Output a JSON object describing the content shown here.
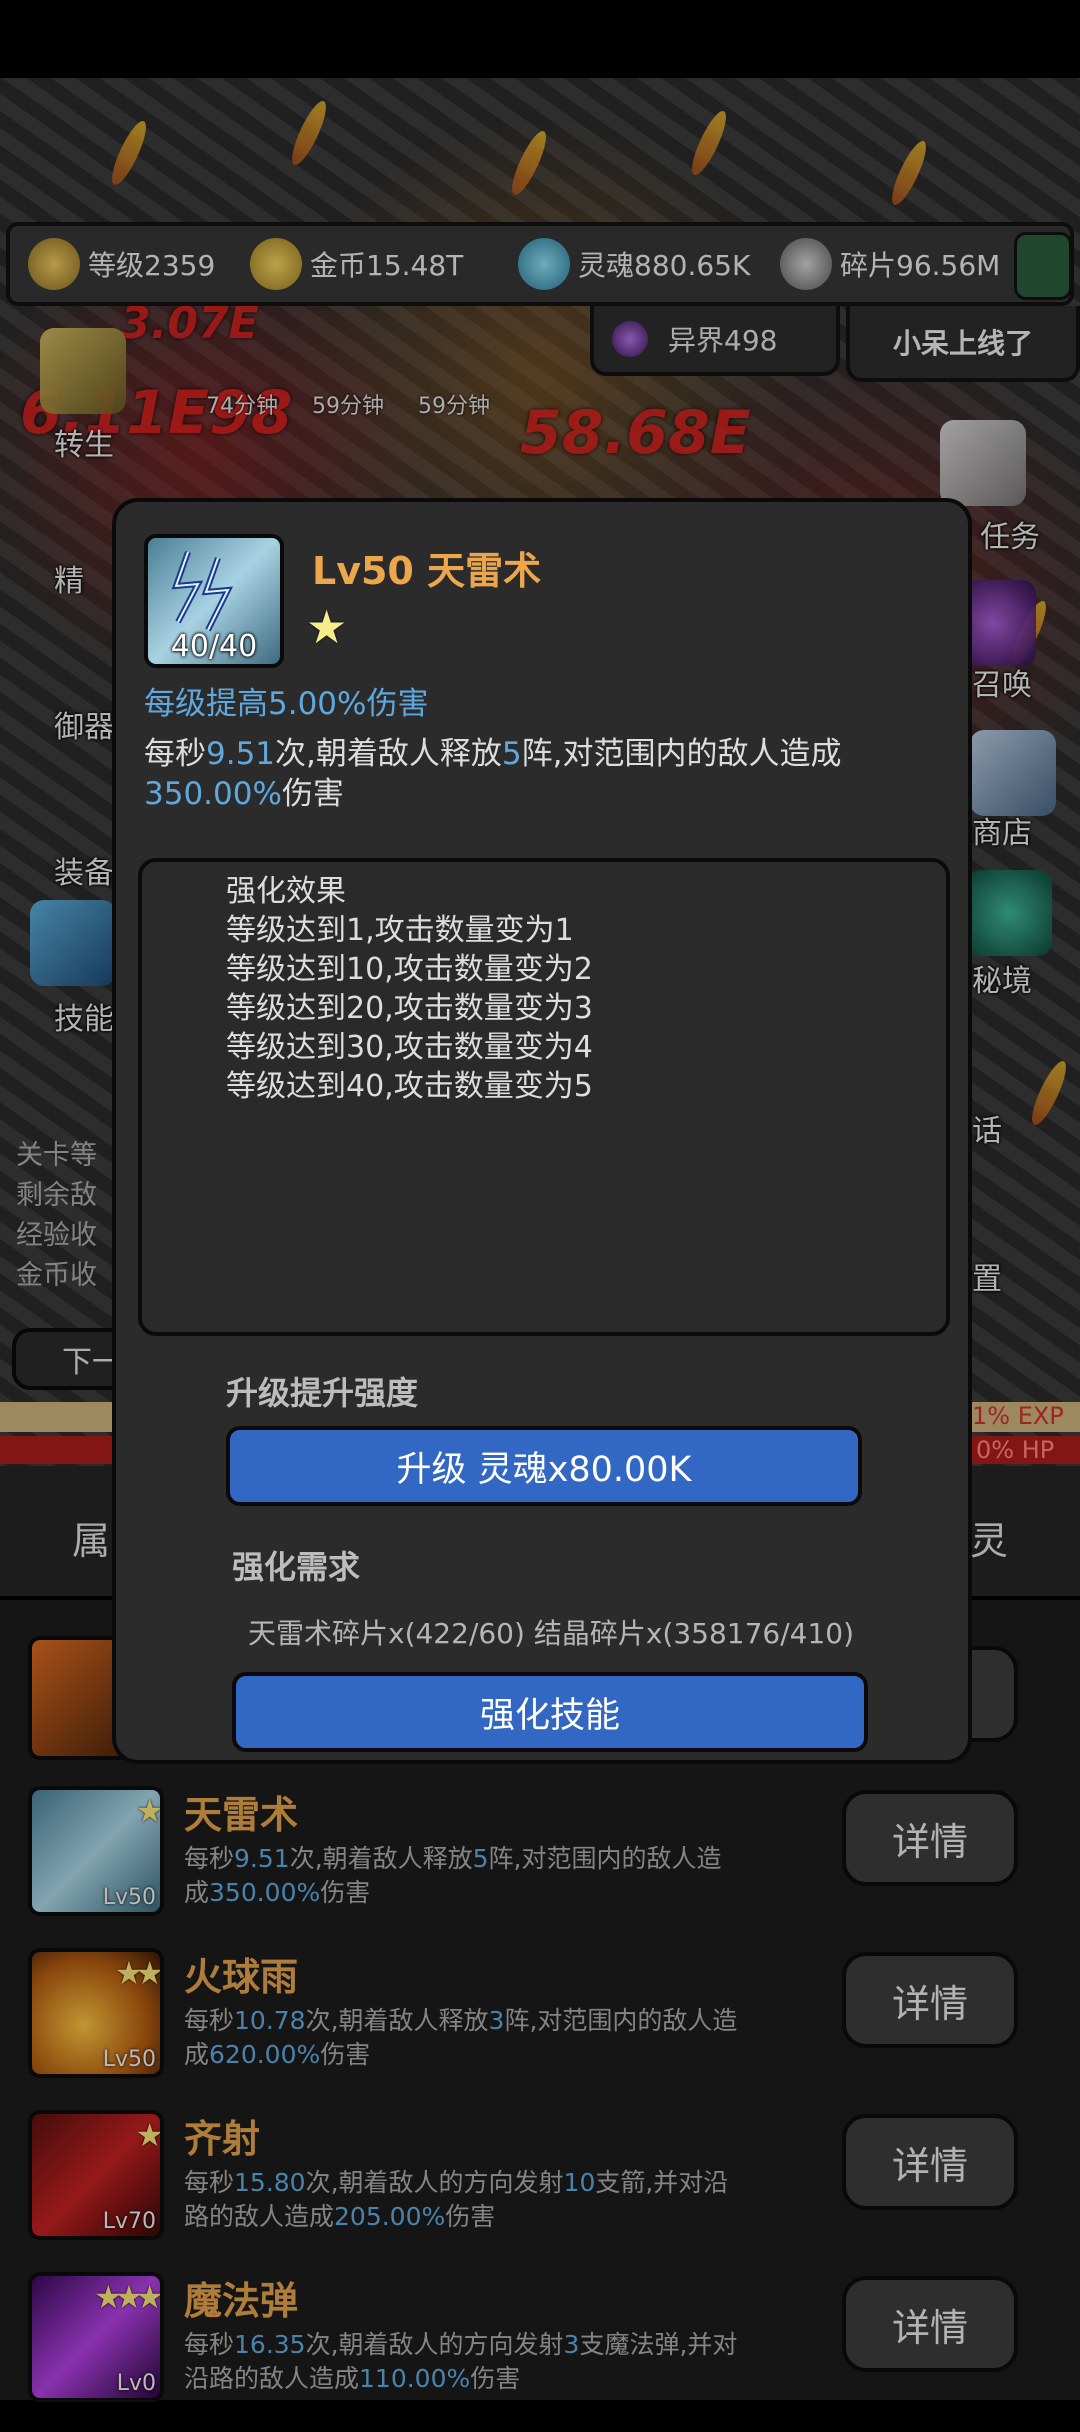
{
  "resources": {
    "level": "等级2359",
    "gold": "金币15.48T",
    "soul": "灵魂880.65K",
    "fragments": "碎片96.56M",
    "realm": "异界498",
    "online": "小呆上线了"
  },
  "timers": [
    "74分钟",
    "59分钟",
    "59分钟"
  ],
  "left_menu": [
    "转生",
    "精",
    "御器",
    "装备",
    "技能"
  ],
  "right_menu": [
    "任务",
    "召唤",
    "商店",
    "秘境",
    "话",
    "置"
  ],
  "stage_info": [
    "关卡等",
    "剩余敌",
    "经验收",
    "金币收"
  ],
  "next_label": "下一",
  "exp_label": "1% EXP",
  "hp_label": "0% HP",
  "tab_left": "属",
  "tab_right": "灵",
  "modal": {
    "icon_count": "40/40",
    "title": "Lv50 天雷术",
    "star": "★",
    "per_level": "每级提高5.00%伤害",
    "desc_prefix": "每秒",
    "desc_rate": "9.51",
    "desc_mid1": "次,朝着敌人释放",
    "desc_count": "5",
    "desc_mid2": "阵,对范围内的敌人造成",
    "desc_pct": "350.00%",
    "desc_suffix": "伤害",
    "effects": [
      "强化效果",
      "等级达到1,攻击数量变为1",
      "等级达到10,攻击数量变为2",
      "等级达到20,攻击数量变为3",
      "等级达到30,攻击数量变为4",
      "等级达到40,攻击数量变为5"
    ],
    "upgrade_label": "升级提升强度",
    "upgrade_button": "升级 灵魂x80.00K",
    "require_label": "强化需求",
    "require_text": "天雷术碎片x(422/60) 结晶碎片x(358176/410)",
    "enhance_button": "强化技能"
  },
  "skills": [
    {
      "name": "天雷术",
      "lv": "Lv50",
      "stars": "★",
      "a": "每秒",
      "n1": "9.51",
      "b": "次,朝着敌人释放",
      "n2": "5",
      "c": "阵,对范围内的敌人造成",
      "n3": "350.00%",
      "d": "伤害",
      "button": "详情"
    },
    {
      "name": "火球雨",
      "lv": "Lv50",
      "stars": "★★",
      "a": "每秒",
      "n1": "10.78",
      "b": "次,朝着敌人释放",
      "n2": "3",
      "c": "阵,对范围内的敌人造成",
      "n3": "620.00%",
      "d": "伤害",
      "button": "详情"
    },
    {
      "name": "齐射",
      "lv": "Lv70",
      "stars": "★",
      "a": "每秒",
      "n1": "15.80",
      "b": "次,朝着敌人的方向发射",
      "n2": "10",
      "c": "支箭,并对沿路的敌人造成",
      "n3": "205.00%",
      "d": "伤害",
      "button": "详情"
    },
    {
      "name": "魔法弹",
      "lv": "Lv0",
      "stars": "★★★",
      "a": "每秒",
      "n1": "16.35",
      "b": "次,朝着敌人的方向发射",
      "n2": "3",
      "c": "支魔法弹,并对沿路的敌人造成",
      "n3": "110.00%",
      "d": "伤害",
      "button": "详情"
    }
  ],
  "colors": {
    "accent_blue": "#3367c4",
    "highlight": "#5ea8dd",
    "title_orange": "#eca74c"
  }
}
